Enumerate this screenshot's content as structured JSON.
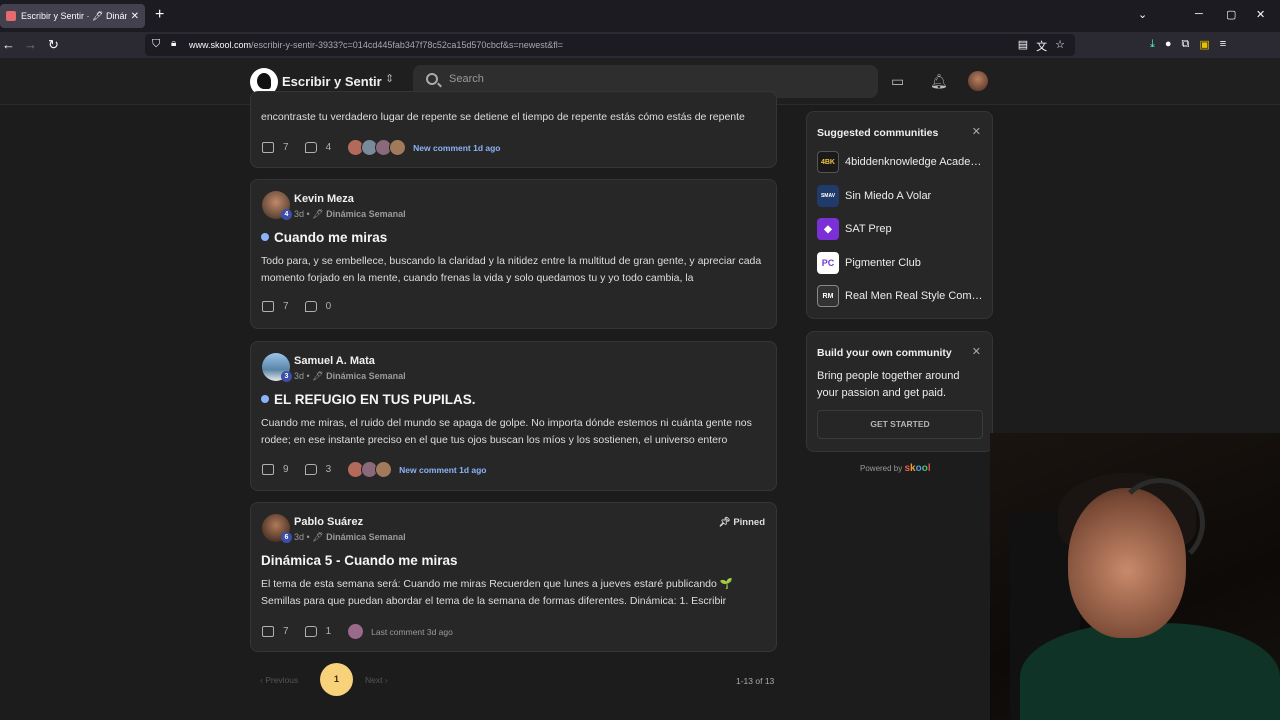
{
  "browser": {
    "tab_title": "Escribir y Sentir · 🖋 Dinámica",
    "url_domain": "www.skool.com",
    "url_path": "/escribir-y-sentir-3933?c=014cd445fab347f78c52ca15d570cbcf&s=newest&fl="
  },
  "header": {
    "community_name": "Escribir y Sentir",
    "search_placeholder": "Search"
  },
  "posts": [
    {
      "body": "encontraste tu verdadero lugar de repente se detiene el tiempo de repente estás cómo estás de repente",
      "likes": "7",
      "comments": "4",
      "activity": "New comment 1d ago"
    },
    {
      "author": "Kevin Meza",
      "level": "4",
      "time": "3d",
      "category": "Dinámica Semanal",
      "title": "Cuando me miras",
      "body": "Todo para, y se embellece, buscando la claridad y la nitidez entre la multitud de gran gente, y apreciar cada momento forjado en la mente, cuando frenas la vida y solo quedamos tu y yo todo cambia, la",
      "likes": "7",
      "comments": "0"
    },
    {
      "author": "Samuel A. Mata",
      "level": "3",
      "time": "3d",
      "category": "Dinámica Semanal",
      "title": "EL REFUGIO EN TUS PUPILAS.",
      "body": "Cuando me miras, el ruido del mundo se apaga de golpe. No importa dónde estemos ni cuánta gente nos rodee; en ese instante preciso en el que tus ojos buscan los míos y los sostienen, el universo entero",
      "likes": "9",
      "comments": "3",
      "activity": "New comment 1d ago"
    },
    {
      "author": "Pablo Suárez",
      "level": "6",
      "time": "3d",
      "category": "Dinámica Semanal",
      "pinned": "Pinned",
      "title": "Dinámica 5 - Cuando me miras",
      "body": "El tema de esta semana será: Cuando me miras Recuerden que lunes a jueves estaré publicando 🌱 Semillas para que puedan abordar el tema de la semana de formas diferentes. Dinámica: 1. Escribir",
      "likes": "7",
      "comments": "1",
      "activity": "Last comment 3d ago"
    }
  ],
  "pagination": {
    "previous": "Previous",
    "current": "1",
    "next": "Next",
    "count": "1-13 of 13"
  },
  "sidebar": {
    "suggested_title": "Suggested communities",
    "communities": [
      {
        "name": "4biddenknowledge Acade…",
        "icon_text": "4BK",
        "color": "#1a1a1a"
      },
      {
        "name": "Sin Miedo A Volar",
        "icon_text": "SMAV",
        "color": "#203a6a"
      },
      {
        "name": "SAT Prep",
        "icon_text": "◆",
        "color": "#7b2fd6"
      },
      {
        "name": "Pigmenter Club",
        "icon_text": "PC",
        "color": "#ffffff"
      },
      {
        "name": "Real Men Real Style Com…",
        "icon_text": "RM",
        "color": "#333333"
      }
    ],
    "build_title": "Build your own community",
    "build_text": "Bring people together around your passion and get paid.",
    "build_button": "GET STARTED",
    "powered_by": "Powered by",
    "powered_brand": "skool"
  }
}
